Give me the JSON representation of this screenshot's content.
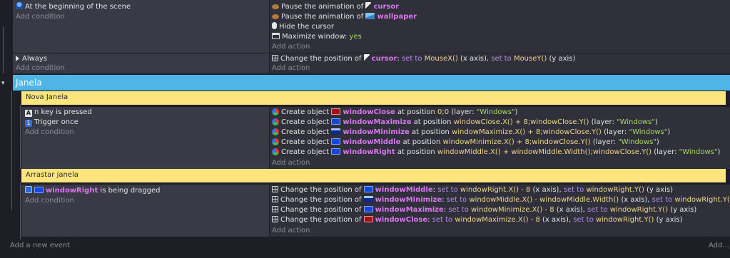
{
  "events": {
    "scene_start": {
      "condition": "At the beginning of the scene",
      "add_condition": "Add condition",
      "actions": [
        {
          "prefix": "Pause the animation of ",
          "object": "cursor"
        },
        {
          "prefix": "Pause the animation of ",
          "object": "wallpaper"
        },
        {
          "text": "Hide the cursor"
        },
        {
          "prefix": "Maximize window: ",
          "value": "yes"
        }
      ],
      "add_action": "Add action"
    },
    "always": {
      "condition": "Always",
      "add_condition": "Add condition",
      "action": {
        "prefix": "Change the position of ",
        "object": "cursor",
        "sep": ": ",
        "set1": "set to ",
        "val1": "MouseX()",
        "axis1": " (x axis), ",
        "set2": "set to ",
        "val2": "MouseY()",
        "axis2": " (y axis)"
      },
      "add_action": "Add action"
    }
  },
  "group": {
    "title": "Janela"
  },
  "comments": {
    "nova": "Nova Janela",
    "arrastar": "Arrastar janela"
  },
  "nova_event": {
    "conditions": [
      "n key is pressed",
      "Trigger once"
    ],
    "key_icon_text": "A",
    "trigger_icon_text": "1",
    "add_condition": "Add condition",
    "actions": [
      {
        "object": "windowClose",
        "pos": "0;0",
        "layer": "\"Windows\""
      },
      {
        "object": "windowMaximize",
        "pos": "windowClose.X() + 8;windowClose.Y()",
        "layer": "\"Windows\""
      },
      {
        "object": "windowMinimize",
        "pos": "windowMaximize.X() + 8;windowClose.Y()",
        "layer": "\"Windows\""
      },
      {
        "object": "windowMiddle",
        "pos": "windowMinimize.X() + 8;windowClose.Y()",
        "layer": "\"Windows\""
      },
      {
        "object": "windowRight",
        "pos": "windowMiddle.X() + windowMiddle.Width();windowClose.Y()",
        "layer": "\"Windows\""
      }
    ],
    "create_label": "Create object ",
    "at_position": " at position ",
    "layer_open": " (layer: ",
    "layer_close": ")",
    "add_action": "Add action"
  },
  "drag_event": {
    "object": "windowRight",
    "condition_suffix": " is being dragged",
    "add_condition": "Add condition",
    "actions": [
      {
        "object": "windowMiddle",
        "x": "windowRight.X() - 8",
        "y": "windowRight.Y()"
      },
      {
        "object": "windowMinimize",
        "x": "windowMiddle.X() - windowMiddle.Width()",
        "y": "windowRight.Y()"
      },
      {
        "object": "windowMaximize",
        "x": "windowMinimize.X() - 8",
        "y": "windowRight.Y()"
      },
      {
        "object": "windowClose",
        "x": "windowMaximize.X() - 8",
        "y": "windowRight.Y()"
      }
    ],
    "change_label": "Change the position of ",
    "set_to": "set to ",
    "x_axis": " (x axis), ",
    "y_axis": " (y axis)",
    "add_action": "Add action"
  },
  "footer": {
    "add_event": "Add a new event",
    "add_more": "Add..."
  },
  "colors": {
    "group": "#4db6e6",
    "comment": "#fde47c",
    "object": "#d977ef"
  }
}
